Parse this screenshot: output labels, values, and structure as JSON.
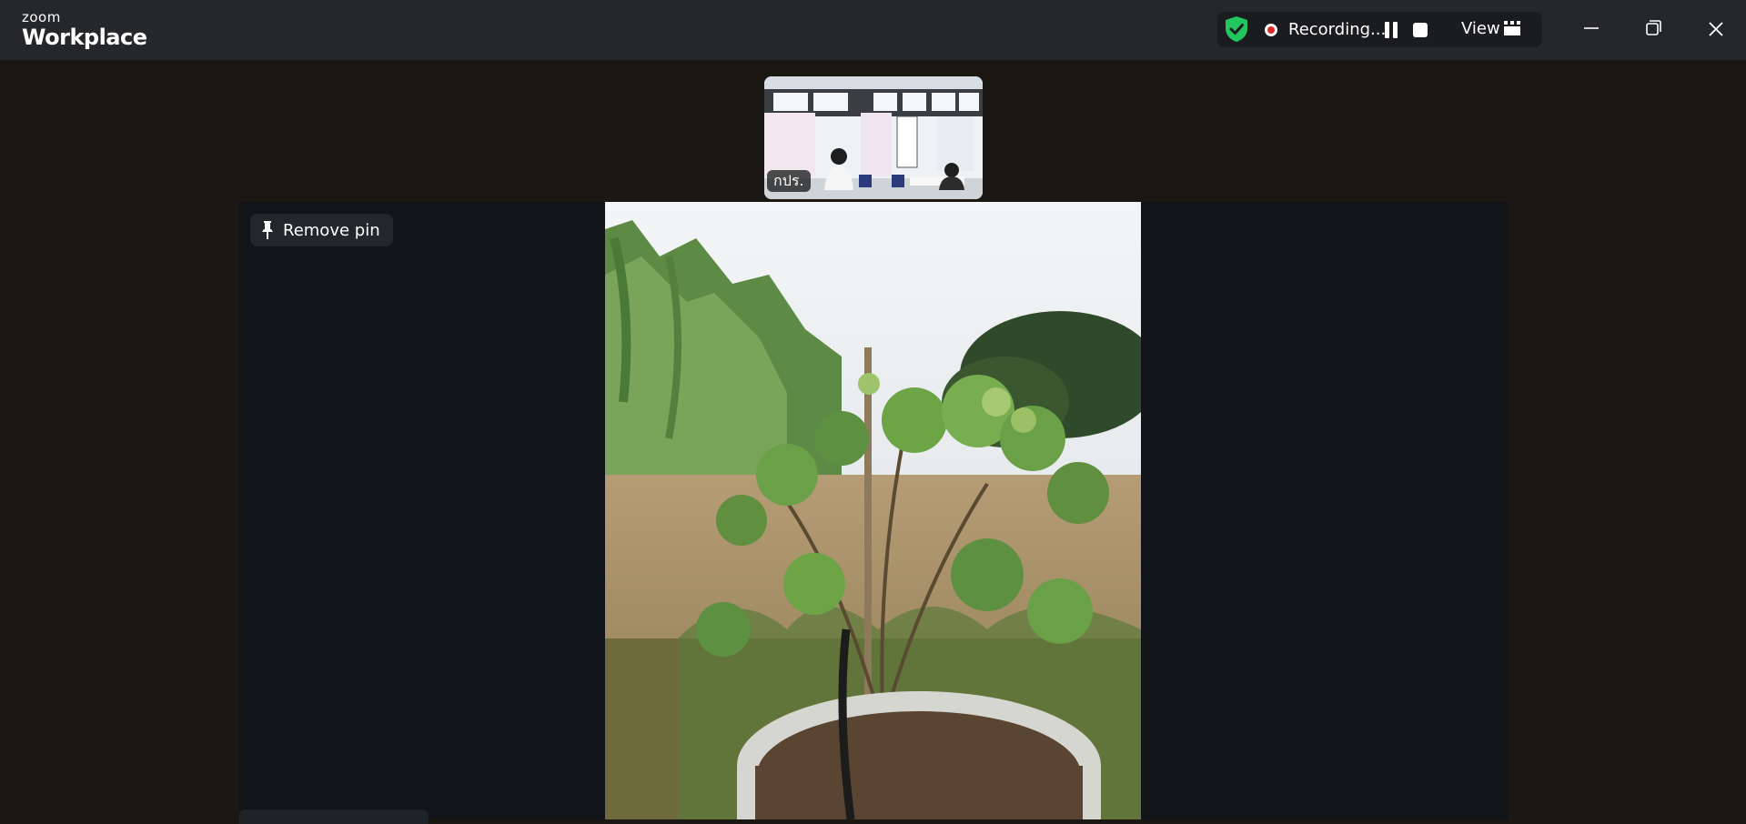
{
  "app": {
    "brand_small": "zoom",
    "brand_big": "Workplace"
  },
  "recording_bar": {
    "status_text": "Recording...",
    "view_label": "View",
    "shield_color": "#22c55e",
    "rec_dot_color": "#e02828"
  },
  "participants": {
    "thumbnail_name": "กปร."
  },
  "pinned": {
    "remove_pin_label": "Remove pin",
    "bottom_name_label": ""
  },
  "icons": {
    "shield": "shield-check-icon",
    "pause": "pause-icon",
    "stop": "stop-icon",
    "view": "grid-view-icon",
    "minimize": "minimize-icon",
    "maximize": "restore-icon",
    "close": "close-icon",
    "pin": "pin-icon"
  }
}
